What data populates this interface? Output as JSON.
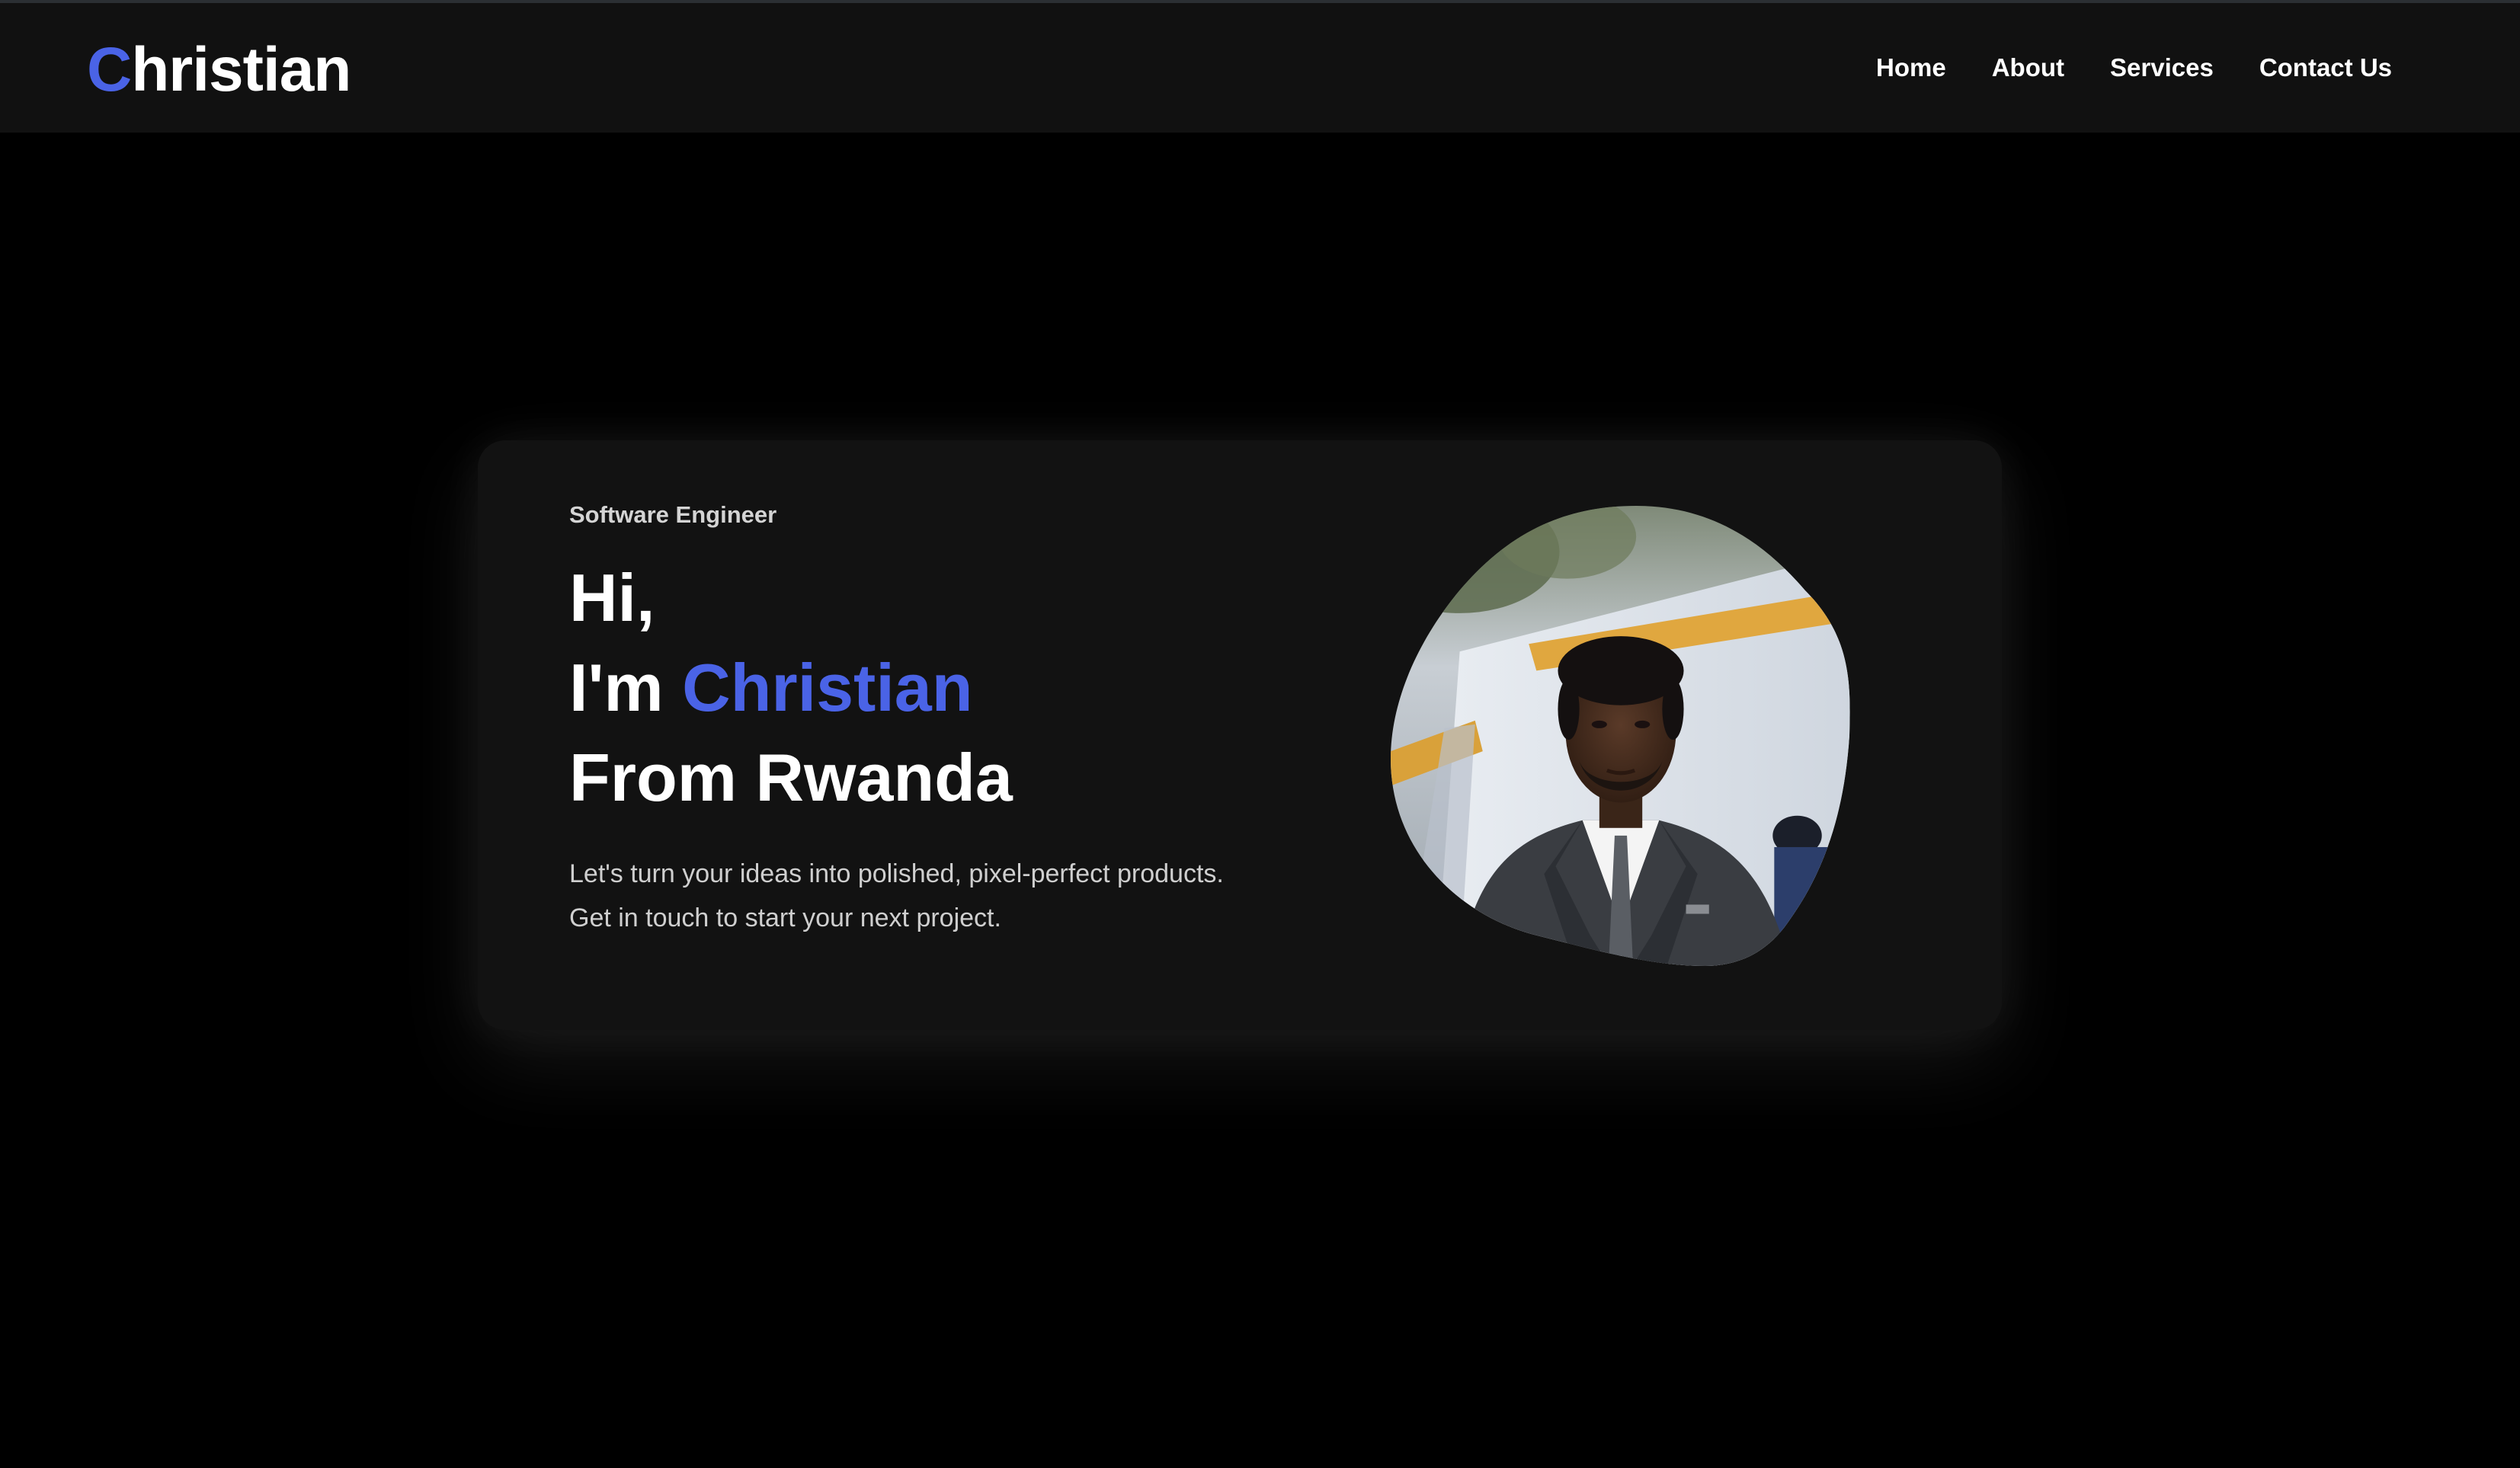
{
  "navbar": {
    "logo_initial": "C",
    "logo_rest": "hristian",
    "links": [
      "Home",
      "About",
      "Services",
      "Contact Us"
    ]
  },
  "hero": {
    "role": "Software Engineer",
    "greeting": "Hi,",
    "intro_prefix": "I'm ",
    "name": "Christian",
    "origin": "From Rwanda",
    "description_line1": "Let's turn your ideas into polished, pixel-perfect products.",
    "description_line2": "Get in touch to start your next project."
  },
  "colors": {
    "accent": "#4a63e6",
    "background": "#000000",
    "navbar": "#111111",
    "card": "#121212"
  },
  "icons": {
    "portrait": "profile-photo-blob"
  }
}
